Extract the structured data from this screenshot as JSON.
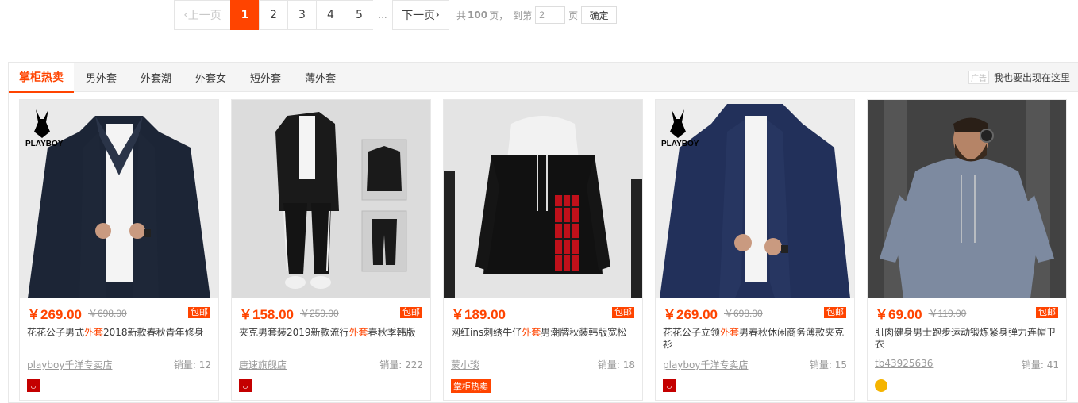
{
  "pagination": {
    "prev": "上一页",
    "pages": [
      "1",
      "2",
      "3",
      "4",
      "5"
    ],
    "ellipsis": "...",
    "next": "下一页",
    "total_prefix": "共",
    "total_pages": "100",
    "total_suffix": "页，",
    "goto_prefix": "到第",
    "goto_value": "2",
    "goto_suffix": "页",
    "confirm": "确定"
  },
  "section": {
    "tabs": [
      "掌柜热卖",
      "男外套",
      "外套潮",
      "外套女",
      "短外套",
      "薄外套"
    ],
    "ad_tag": "广告",
    "ad_link": "我也要出现在这里"
  },
  "products": [
    {
      "price": "￥269.00",
      "old_price": "￥698.00",
      "free_ship": "包邮",
      "title_before": "花花公子男式",
      "title_highlight": "外套",
      "title_after": "2018新款春秋青年修身",
      "shop": "playboy千洋专卖店",
      "sales": "销量: 12",
      "badge": "red",
      "image": "playboy-navy-jacket"
    },
    {
      "price": "￥158.00",
      "old_price": "￥259.00",
      "free_ship": "包邮",
      "title_before": "夹克男套装2019新款流行",
      "title_highlight": "外套",
      "title_after": "春秋季韩版",
      "shop": "唐速旗舰店",
      "sales": "销量: 222",
      "badge": "red",
      "image": "black-tracksuit"
    },
    {
      "price": "￥189.00",
      "old_price": "",
      "free_ship": "包邮",
      "title_before": "网红ins刺绣牛仔",
      "title_highlight": "外套",
      "title_after": "男潮牌秋装韩版宽松",
      "shop": "蒙小琰",
      "sales": "销量: 18",
      "badge": "hot",
      "badge_text": "掌柜热卖",
      "image": "denim-jacket-plaid"
    },
    {
      "price": "￥269.00",
      "old_price": "￥698.00",
      "free_ship": "包邮",
      "title_before": "花花公子立领",
      "title_highlight": "外套",
      "title_after": "男春秋休闲商务薄款夹克衫",
      "shop": "playboy千洋专卖店",
      "sales": "销量: 15",
      "badge": "red",
      "image": "playboy-blue-jacket"
    },
    {
      "price": "￥69.00",
      "old_price": "￥119.00",
      "free_ship": "包邮",
      "title_before": "肌肉健身男士跑步运动锻炼紧身弹力连帽卫衣",
      "title_highlight": "",
      "title_after": "",
      "shop": "tb43925636",
      "sales": "销量: 41",
      "badge": "crown",
      "image": "gray-fitness-hoodie"
    }
  ]
}
